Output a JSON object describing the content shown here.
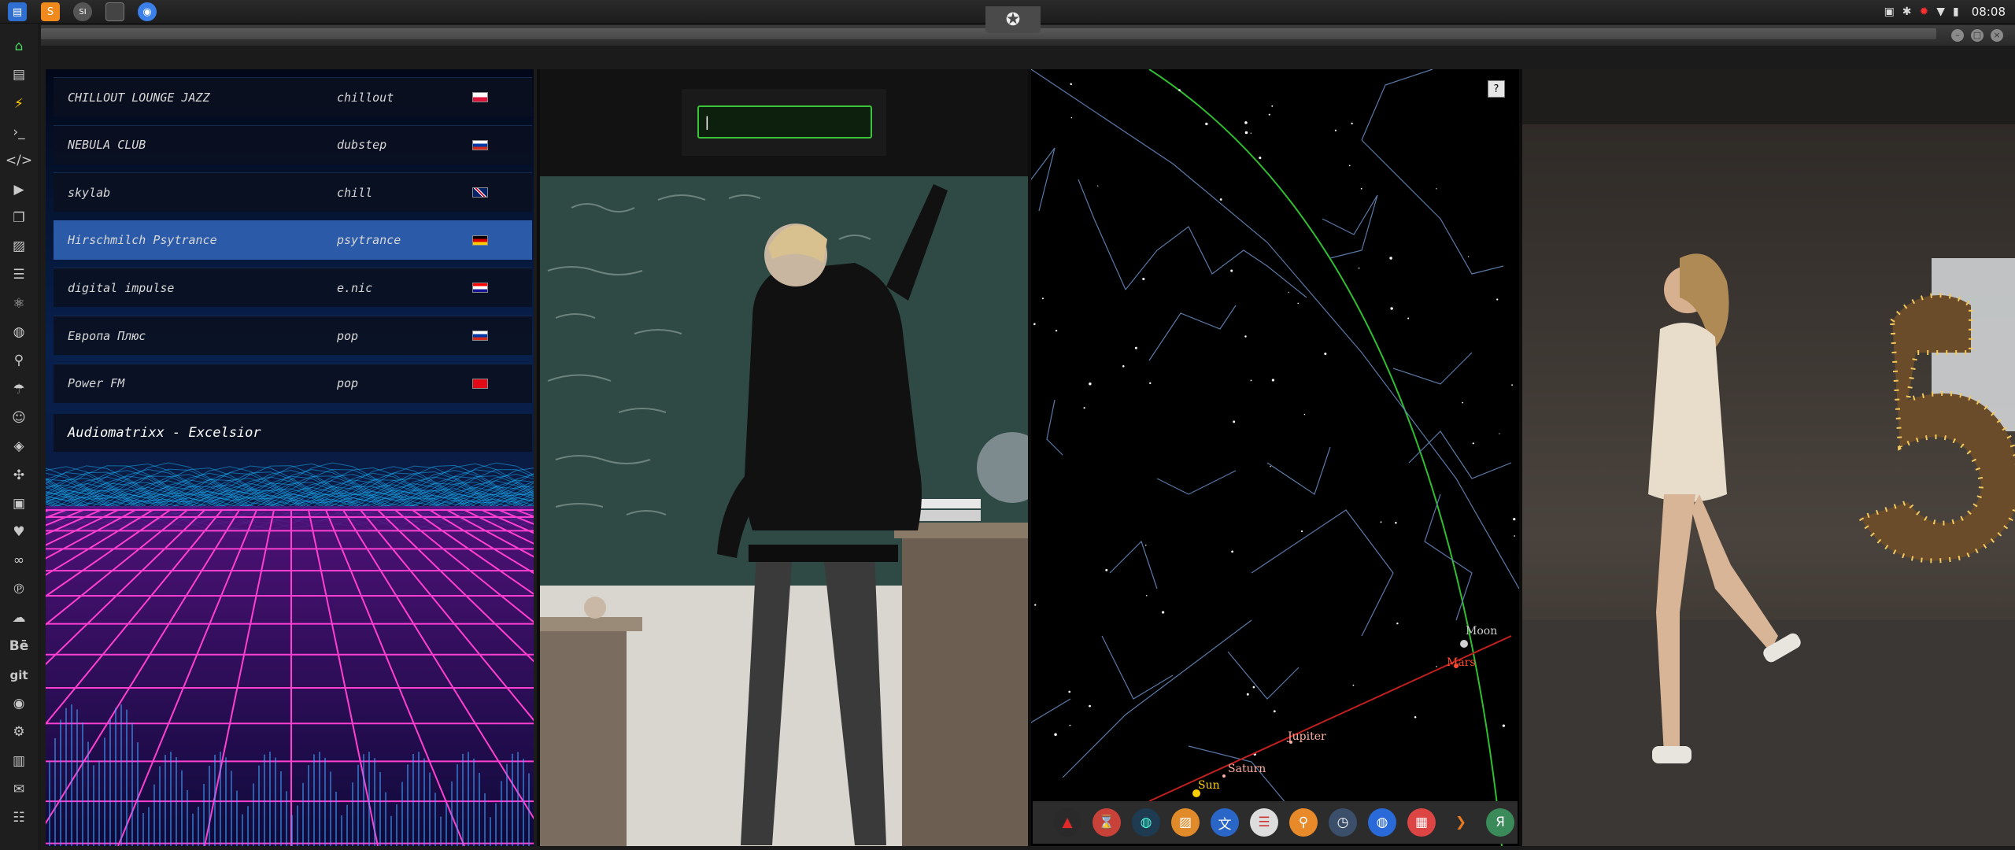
{
  "topbar": {
    "apps": [
      "files-icon",
      "sublime-icon",
      "si-app-icon",
      "terminal-app-icon",
      "chrome-icon"
    ],
    "si_label": "SI",
    "clock": "08:08"
  },
  "dock": [
    "home-icon",
    "document-icon",
    "bolt-icon",
    "terminal-icon",
    "code-icon",
    "play-icon",
    "files-copy-icon",
    "image-icon",
    "news-icon",
    "react-icon",
    "globe-icon",
    "search-icon",
    "umbrella-icon",
    "contacts-icon",
    "tags-icon",
    "network-icon",
    "youtube-icon",
    "heart-icon",
    "infinity-icon",
    "pinterest-icon",
    "cloud-icon",
    "behance-icon",
    "git-icon",
    "github-icon",
    "bikes-icon",
    "map-icon",
    "mail-icon",
    "server-icon"
  ],
  "dock_labels": {
    "behance": "Bē",
    "git": "git"
  },
  "radio": {
    "stations": [
      {
        "name": "CHILLOUT LOUNGE JAZZ",
        "genre": "chillout",
        "flag": "pl"
      },
      {
        "name": "NEBULA CLUB",
        "genre": "dubstep",
        "flag": "ru"
      },
      {
        "name": "skylab",
        "genre": "chill",
        "flag": "gb"
      },
      {
        "name": "Hirschmilch Psytrance",
        "genre": "psytrance",
        "flag": "de"
      },
      {
        "name": "digital impulse",
        "genre": "e.nic",
        "flag": "hr"
      },
      {
        "name": "Европа Плюс",
        "genre": "pop",
        "flag": "ru"
      },
      {
        "name": "Power FM",
        "genre": "pop",
        "flag": "tr"
      }
    ],
    "active_index": 3,
    "now_playing": "Audiomatrixx - Excelsior"
  },
  "search": {
    "value": "|"
  },
  "starmap": {
    "help": "?",
    "labels": {
      "moon": "Moon",
      "mars": "Mars",
      "jupiter": "Jupiter",
      "saturn": "Saturn",
      "sun": "Sun"
    }
  },
  "panel_dock": [
    "triangle-app-icon",
    "hourglass-icon",
    "globe-dark-icon",
    "photos-icon",
    "translate-icon",
    "calendar-list-icon",
    "search-orange-icon",
    "clock-icon",
    "earth-icon",
    "calendar-icon",
    "arrow-icon",
    "yandex-icon"
  ],
  "panel_dock_labels": {
    "yandex": "Я"
  },
  "colors": {
    "accent_green": "#39c439",
    "active_row": "#2b5aa8",
    "neon_pink": "#ff3fd0",
    "neon_blue": "#19b7ff"
  }
}
